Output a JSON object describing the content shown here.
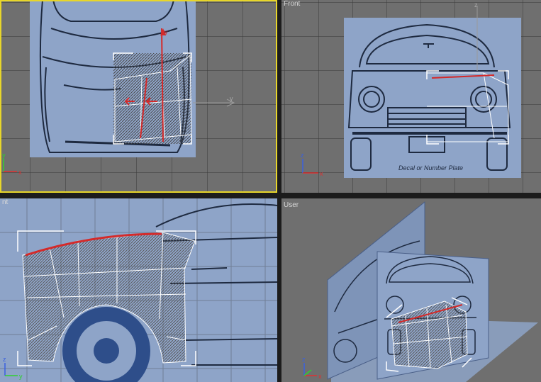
{
  "viewports": {
    "top": {
      "label": "",
      "active": true
    },
    "front": {
      "label": "Front",
      "plate_text": "Decal or Number Plate"
    },
    "left": {
      "label": "nt"
    },
    "user": {
      "label": "User"
    }
  },
  "axis_letters": {
    "x": "x",
    "y": "y",
    "z": "z"
  },
  "colors": {
    "viewport_bg": "#6f6f6f",
    "grid": "#3a3a3a",
    "blueprint": "#8ea4c8",
    "selection": "#ffffff",
    "active_border": "#e8d62a",
    "highlight": "#d42a2a"
  }
}
